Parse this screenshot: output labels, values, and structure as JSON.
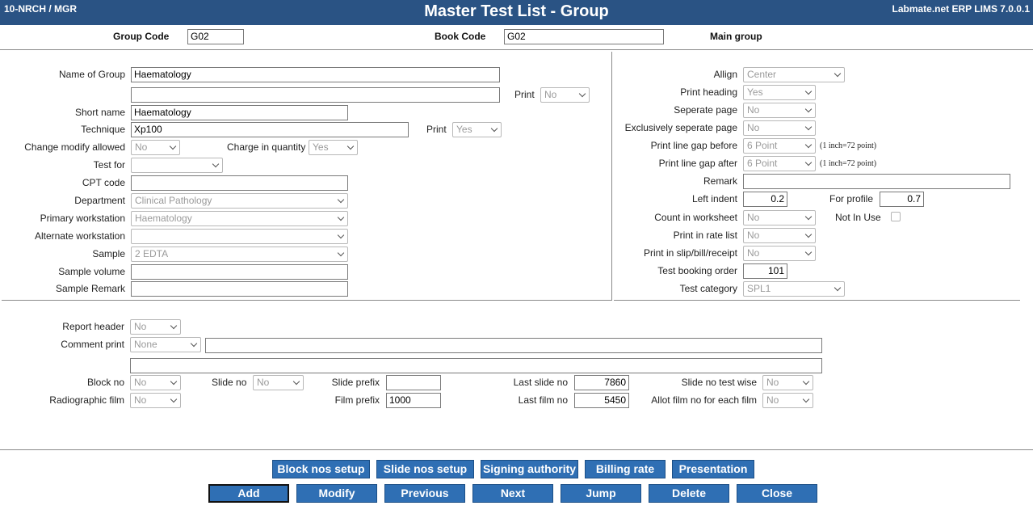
{
  "header": {
    "left": "10-NRCH / MGR",
    "title": "Master Test List - Group",
    "right": "Labmate.net ERP LIMS 7.0.0.1"
  },
  "top": {
    "group_code_label": "Group Code",
    "group_code_value": "G02",
    "book_code_label": "Book Code",
    "book_code_value": "G02",
    "main_group_label": "Main group"
  },
  "left": {
    "name_of_group_label": "Name of Group",
    "name_of_group_value": "Haematology",
    "name_line2_value": "",
    "print1_label": "Print",
    "print1_value": "No",
    "short_name_label": "Short name",
    "short_name_value": "Haematology",
    "technique_label": "Technique",
    "technique_value": "Xp100",
    "print2_label": "Print",
    "print2_value": "Yes",
    "change_modify_label": "Change modify allowed",
    "change_modify_value": "No",
    "charge_qty_label": "Charge in quantity",
    "charge_qty_value": "Yes",
    "test_for_label": "Test for",
    "test_for_value": "",
    "cpt_code_label": "CPT code",
    "cpt_code_value": "",
    "department_label": "Department",
    "department_value": "Clinical Pathology",
    "primary_ws_label": "Primary workstation",
    "primary_ws_value": "Haematology",
    "alternate_ws_label": "Alternate workstation",
    "alternate_ws_value": "",
    "sample_label": "Sample",
    "sample_value": "2 EDTA",
    "sample_volume_label": "Sample volume",
    "sample_volume_value": "",
    "sample_remark_label": "Sample Remark",
    "sample_remark_value": ""
  },
  "right": {
    "allign_label": "Allign",
    "allign_value": "Center",
    "print_heading_label": "Print heading",
    "print_heading_value": "Yes",
    "seperate_page_label": "Seperate page",
    "seperate_page_value": "No",
    "excl_seperate_label": "Exclusively seperate page",
    "excl_seperate_value": "No",
    "gap_before_label": "Print line gap before",
    "gap_before_value": "6 Point",
    "gap_note1": "(1 inch=72 point)",
    "gap_after_label": "Print line gap after",
    "gap_after_value": "6 Point",
    "gap_note2": "(1 inch=72 point)",
    "remark_label": "Remark",
    "remark_value": "",
    "left_indent_label": "Left indent",
    "left_indent_value": "0.2",
    "for_profile_label": "For profile",
    "for_profile_value": "0.7",
    "count_ws_label": "Count in worksheet",
    "count_ws_value": "No",
    "not_in_use_label": "Not In Use",
    "print_rate_label": "Print in rate list",
    "print_rate_value": "No",
    "print_slip_label": "Print in slip/bill/receipt",
    "print_slip_value": "No",
    "booking_order_label": "Test booking order",
    "booking_order_value": "101",
    "test_category_label": "Test category",
    "test_category_value": "SPL1"
  },
  "bottom": {
    "report_header_label": "Report header",
    "report_header_value": "No",
    "comment_print_label": "Comment print",
    "comment_print_value": "None",
    "comment_text1": "",
    "comment_text2": "",
    "block_no_label": "Block no",
    "block_no_value": "No",
    "slide_no_label": "Slide no",
    "slide_no_value": "No",
    "slide_prefix_label": "Slide prefix",
    "slide_prefix_value": "",
    "last_slide_label": "Last slide no",
    "last_slide_value": "7860",
    "slide_test_wise_label": "Slide no test wise",
    "slide_test_wise_value": "No",
    "radiographic_label": "Radiographic film",
    "radiographic_value": "No",
    "film_prefix_label": "Film prefix",
    "film_prefix_value": "1000",
    "last_film_label": "Last film no",
    "last_film_value": "5450",
    "allot_film_label": "Allot film no for each film",
    "allot_film_value": "No"
  },
  "buttons_row1": [
    "Block nos setup",
    "Slide nos setup",
    "Signing authority",
    "Billing rate",
    "Presentation"
  ],
  "buttons_row2": [
    "Add",
    "Modify",
    "Previous",
    "Next",
    "Jump",
    "Delete",
    "Close"
  ]
}
